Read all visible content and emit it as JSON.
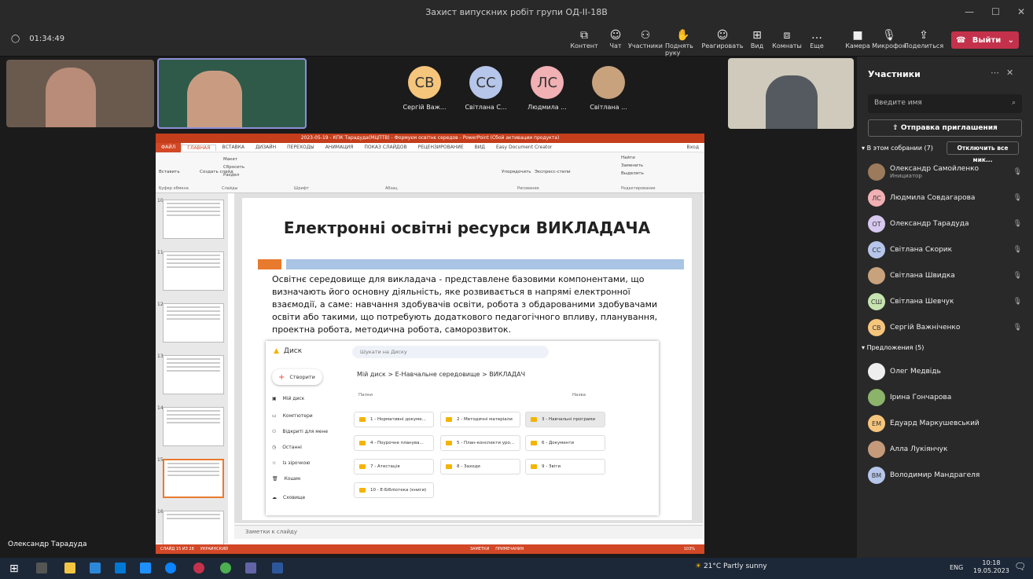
{
  "window": {
    "title": "Захист випускних робіт групи ОД-II-18В",
    "timer": "01:34:49"
  },
  "toolbar": {
    "content": "Контент",
    "chat": "Чат",
    "participants": "Участники",
    "raise_hand": "Поднять руку",
    "reactions": "Реагировать",
    "view": "Вид",
    "rooms": "Комнаты",
    "more": "Еще",
    "camera": "Камера",
    "mic": "Микрофон",
    "share": "Поделиться",
    "leave": "Выйти"
  },
  "tiles": [
    {
      "initials": "СВ",
      "name": "Сергій Важ...",
      "color": "#f5c57c"
    },
    {
      "initials": "СС",
      "name": "Світлана С...",
      "color": "#b6c6ea"
    },
    {
      "initials": "ЛС",
      "name": "Людмила ...",
      "color": "#f1b0b4"
    },
    {
      "initials": "",
      "name": "Світлана ...",
      "color": "#c7a27c"
    }
  ],
  "presenter_name": "Олександр Тарадуда",
  "ppt": {
    "title": "2023-05-19 - КПК Тарадуда(МЦПТВ) - Формуєм освітнє середов - PowerPoint (Сбой активации продукта)",
    "tabs": [
      "ФАЙЛ",
      "ГЛАВНАЯ",
      "ВСТАВКА",
      "ДИЗАЙН",
      "ПЕРЕХОДЫ",
      "АНИМАЦИЯ",
      "ПОКАЗ СЛАЙДОВ",
      "РЕЦЕНЗИРОВАНИЕ",
      "ВИД",
      "Easy Document Creator"
    ],
    "login": "Вход",
    "groups": [
      "Буфер обмена",
      "Слайды",
      "Шрифт",
      "Абзац",
      "Рисование",
      "Редактирование"
    ],
    "ribbon_btns": {
      "paste": "Вставить",
      "create": "Создать слайд",
      "layout": "Макет",
      "reset": "Сбросить",
      "section": "Раздел",
      "arrange": "Упорядочить",
      "styles": "Экспресс-стили",
      "find": "Найти",
      "replace": "Заменить",
      "select": "Выделить"
    },
    "thumb_nums": [
      "10",
      "11",
      "12",
      "13",
      "14",
      "15",
      "16"
    ],
    "notes": "Заметки к слайду",
    "status": "СЛАЙД 15 ИЗ 28",
    "lang": "УКРАИНСКИЙ",
    "notes_btn": "ЗАМЕТКИ",
    "comments_btn": "ПРИМЕЧАНИЯ",
    "zoom": "103%"
  },
  "slide": {
    "title": "Електронні освітні ресурси ВИКЛАДАЧА",
    "body": "Освітнє середовище для викладача - представлене базовими компонентами, що визначають його основну діяльність, яке розвивається в напрямі електронної взаємодії, а саме: навчання здобувачів освіти, робота з обдарованими здобувачами освіти або такими, що потребують додаткового педагогічного впливу, планування, проектна робота, методична робота, саморозвиток."
  },
  "drive": {
    "app": "Диск",
    "search": "Шукати на Диску",
    "create": "Створити",
    "nav": [
      "Мій диск",
      "Комп'ютери",
      "Відкриті для мене",
      "Останні",
      "Із зірочкою",
      "Кошик",
      "Сховище"
    ],
    "breadcrumb": "Мій диск  >  Е-Навчальне середовище  >  ВИКЛАДАЧ",
    "folders_label": "Папки",
    "sort_label": "Назва",
    "folders": [
      "1 - Нормативні докуме...",
      "2 - Методичні матеріали",
      "3 - Навчальні програми",
      "4 - Поурочне планува...",
      "5 - План-конспекти уро...",
      "6 - Документи",
      "7 - Атестація",
      "8 - Заходи",
      "9 - Звіти",
      "10 - Е-Бібліотека (книги)"
    ]
  },
  "panel": {
    "title": "Участники",
    "search_placeholder": "Введите имя",
    "invite": "Отправка приглашения",
    "in_meeting": "В этом собрании (7)",
    "mute_all": "Отключить все мик...",
    "suggestions": "Предложения (5)",
    "members": [
      {
        "name": "Олександр Самойленко",
        "sub": "Инициатор",
        "initials": "",
        "color": "#9b7b5c"
      },
      {
        "name": "Людмила Совдагарова",
        "sub": "",
        "initials": "ЛС",
        "color": "#f1b0b4"
      },
      {
        "name": "Олександр Тарадуда",
        "sub": "",
        "initials": "ОТ",
        "color": "#d6c8ee"
      },
      {
        "name": "Світлана Скорик",
        "sub": "",
        "initials": "СС",
        "color": "#b6c6ea"
      },
      {
        "name": "Світлана Швидка",
        "sub": "",
        "initials": "",
        "color": "#c7a27c"
      },
      {
        "name": "Світлана Шевчук",
        "sub": "",
        "initials": "СШ",
        "color": "#c6e3b0"
      },
      {
        "name": "Сергій Важніченко",
        "sub": "",
        "initials": "СВ",
        "color": "#f5c57c"
      }
    ],
    "suggested": [
      {
        "name": "Олег Медвідь",
        "initials": "",
        "color": "#eeeeee"
      },
      {
        "name": "Ірина Гончарова",
        "initials": "",
        "color": "#8bb36a"
      },
      {
        "name": "Едуард Маркушевський",
        "initials": "ЕМ",
        "color": "#f5c57c"
      },
      {
        "name": "Алла Лукіянчук",
        "initials": "",
        "color": "#c49a7a"
      },
      {
        "name": "Володимир Мандрагеля",
        "initials": "ВМ",
        "color": "#b6c6ea"
      }
    ]
  },
  "taskbar": {
    "weather": "21°C  Partly sunny",
    "lang": "ENG",
    "time": "10:18",
    "date": "19.05.2023"
  }
}
